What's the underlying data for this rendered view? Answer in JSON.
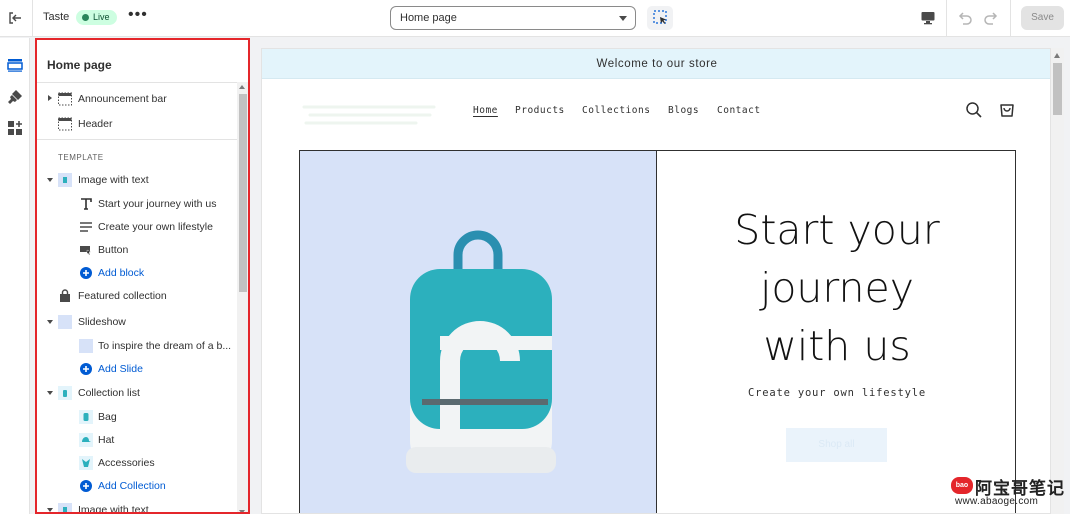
{
  "topbar": {
    "theme_name": "Taste",
    "status_badge": "Live",
    "more": "•••",
    "page_select_value": "Home page",
    "save_label": "Save"
  },
  "sidebar": {
    "title": "Home page",
    "template_label": "TEMPLATE",
    "items": [
      {
        "label": "Announcement bar"
      },
      {
        "label": "Header"
      },
      {
        "label": "Image with text"
      },
      {
        "label": "Start your journey with us"
      },
      {
        "label": "Create your own lifestyle"
      },
      {
        "label": "Button"
      },
      {
        "label": "Add block"
      },
      {
        "label": "Featured collection"
      },
      {
        "label": "Slideshow"
      },
      {
        "label": "To inspire the dream of a b..."
      },
      {
        "label": "Add Slide"
      },
      {
        "label": "Collection list"
      },
      {
        "label": "Bag"
      },
      {
        "label": "Hat"
      },
      {
        "label": "Accessories"
      },
      {
        "label": "Add Collection"
      },
      {
        "label": "Image with text"
      }
    ]
  },
  "preview": {
    "announcement": "Welcome to our store",
    "nav": [
      "Home",
      "Products",
      "Collections",
      "Blogs",
      "Contact"
    ],
    "hero_heading_lines": [
      "Start your",
      "journey",
      "with us"
    ],
    "hero_subheading": "Create your own lifestyle",
    "hero_button": "Shop all"
  },
  "watermark": {
    "logo_text": "bao",
    "chinese": "阿宝哥笔记",
    "url": "www.abaoge.com"
  },
  "colors": {
    "accent_red": "#e4262b",
    "link_blue": "#005bd3",
    "announcement_bg": "#e3f4fb",
    "hero_image_bg": "#d7e2f8",
    "backpack_teal": "#2cb0bd",
    "live_badge_bg": "#cdfee1"
  }
}
